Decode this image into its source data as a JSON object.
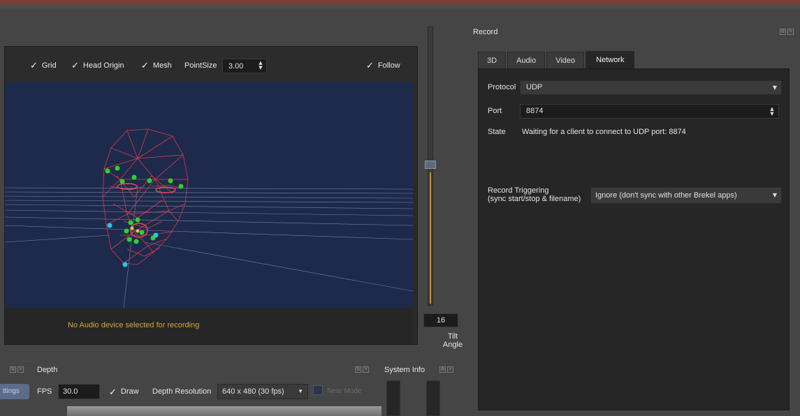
{
  "viewport": {
    "options": [
      {
        "label": "Grid",
        "checked": true
      },
      {
        "label": "Head Origin",
        "checked": true
      },
      {
        "label": "Mesh",
        "checked": true
      }
    ],
    "point_size_label": "PointSize",
    "point_size_value": "3.00",
    "follow_label": "Follow",
    "follow_checked": true,
    "audio_message": "No Audio device selected for recording"
  },
  "tilt": {
    "value": "16",
    "label_line1": "Tilt",
    "label_line2": "Angle"
  },
  "depth": {
    "title": "Depth",
    "settings_tab": "ttings",
    "fps_label": "FPS",
    "fps_value": "30.0",
    "draw_label": "Draw",
    "draw_checked": true,
    "resolution_label": "Depth Resolution",
    "resolution_value": "640 x 480 (30 fps)",
    "near_mode_label": "Near Mode"
  },
  "system_info": {
    "title": "System Info"
  },
  "record": {
    "title": "Record",
    "tabs": [
      {
        "label": "3D",
        "active": false
      },
      {
        "label": "Audio",
        "active": false
      },
      {
        "label": "Video",
        "active": false
      },
      {
        "label": "Network",
        "active": true
      }
    ],
    "protocol_label": "Protocol",
    "protocol_value": "UDP",
    "port_label": "Port",
    "port_value": "8874",
    "state_label": "State",
    "state_value": "Waiting for a client to connect to UDP port: 8874",
    "trigger_label_line1": "Record Triggering",
    "trigger_label_line2": "(sync start/stop & filename)",
    "trigger_value": "Ignore (don't sync with other Brekel apps)"
  },
  "colors": {
    "scene_background": "#1e2a4c",
    "mesh_wire": "#d83a4a",
    "landmark_green": "#2ad42a",
    "landmark_cyan": "#2ac8e8",
    "accent_orange": "#d68a1e",
    "audio_warning": "#d9a437"
  }
}
